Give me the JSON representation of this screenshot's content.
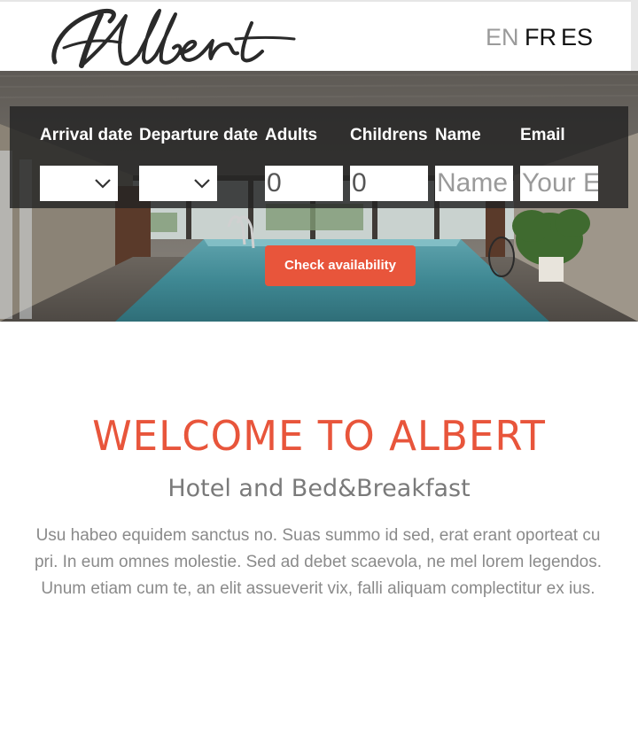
{
  "header": {
    "logo_text": "Albert",
    "languages": [
      "EN",
      "FR",
      "ES"
    ],
    "active_language": "EN"
  },
  "booking_form": {
    "arrival_label": "Arrival date",
    "departure_label": "Departure date",
    "adults_label": "Adults",
    "children_label": "Childrens",
    "name_label": "Name",
    "email_label": "Email",
    "adults_value": "0",
    "children_value": "0",
    "name_placeholder": "Name",
    "email_placeholder": "Your Email",
    "submit_label": "Check availability"
  },
  "welcome": {
    "title": "WELCOME TO ALBERT",
    "subtitle": "Hotel and Bed&Breakfast",
    "body": "Usu habeo equidem sanctus no. Suas summo id sed, erat erant oporteat cu pri. In eum omnes molestie. Sed ad debet scaevola, ne mel lorem legendos. Unum etiam cum te, an elit assueverit vix, falli aliquam complectitur ex ius."
  },
  "colors": {
    "accent": "#e8553b",
    "panel": "#232323",
    "text_muted": "#8a8a8a"
  }
}
